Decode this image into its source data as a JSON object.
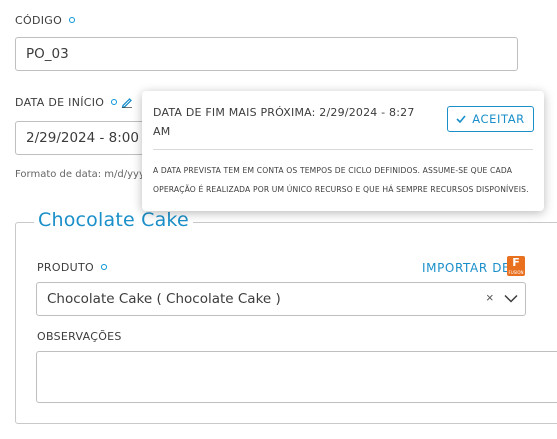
{
  "codigo": {
    "label": "CÓDIGO",
    "value": "PO_03"
  },
  "data_inicio": {
    "label": "DATA DE INÍCIO",
    "value": "2/29/2024 - 8:00 AM",
    "format_hint": "Formato de data: m/d/yyyy"
  },
  "popup": {
    "title": "DATA DE FIM MAIS PRÓXIMA: 2/29/2024 - 8:27 AM",
    "accept_label": "ACEITAR",
    "note": "A DATA PREVISTA TEM EM CONTA OS TEMPOS DE CICLO DEFINIDOS. ASSUME-SE QUE CADA OPERAÇÃO É REALIZADA POR UM ÚNICO RECURSO E QUE HÁ SEMPRE RECURSOS DISPONÍVEIS."
  },
  "product_section": {
    "title": "Chocolate Cake",
    "produto_label": "PRODUTO",
    "import_label": "IMPORTAR DE",
    "import_icon_letter": "F",
    "import_icon_caption": "FUSION",
    "produto_value": "Chocolate Cake ( Chocolate Cake )",
    "clear_symbol": "×",
    "observacoes_label": "OBSERVAÇÕES",
    "observacoes_value": ""
  },
  "colors": {
    "accent": "#1a8fc9",
    "required_dot": "#0696d7",
    "fusion_orange": "#e8701f"
  },
  "icons": {
    "required": "required-dot-icon",
    "edit": "pencil-icon",
    "accept": "check-icon",
    "clear": "clear-icon",
    "dropdown": "chevron-down-icon",
    "import": "fusion-icon"
  }
}
